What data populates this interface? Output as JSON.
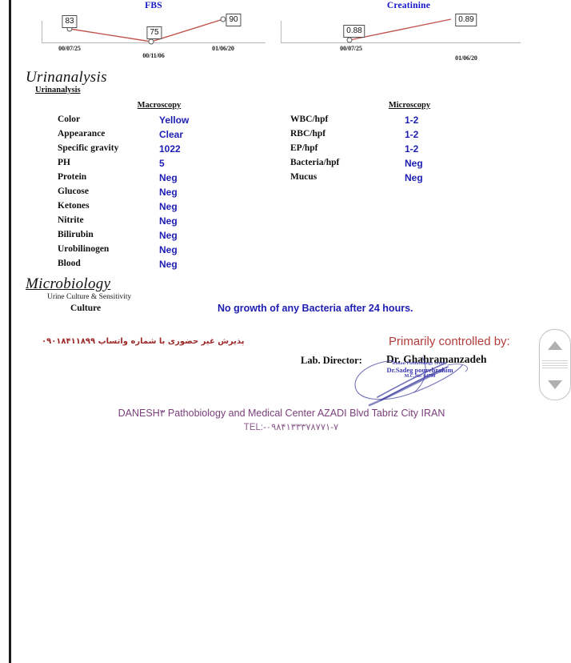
{
  "charts": {
    "fbs": {
      "title": "FBS",
      "points": [
        {
          "value": "83",
          "date": "00/07/25"
        },
        {
          "value": "75",
          "date": "00/11/06"
        },
        {
          "value": "90",
          "date": "01/06/20"
        }
      ]
    },
    "creatinine": {
      "title": "Creatinine",
      "points": [
        {
          "value": "0.88",
          "date": "00/07/25"
        },
        {
          "value": "0.89",
          "date": "01/06/20"
        }
      ]
    }
  },
  "urinalysis": {
    "section_title": "Urinanalysis",
    "sub_title": "Urinanalysis",
    "macroscopy_header": "Macroscopy",
    "microscopy_header": "Microscopy",
    "macroscopy": [
      {
        "label": "Color",
        "value": "Yellow"
      },
      {
        "label": "Appearance",
        "value": "Clear"
      },
      {
        "label": "Specific gravity",
        "value": "1022"
      },
      {
        "label": "PH",
        "value": "5"
      },
      {
        "label": "Protein",
        "value": "Neg"
      },
      {
        "label": "Glucose",
        "value": "Neg"
      },
      {
        "label": "Ketones",
        "value": "Neg"
      },
      {
        "label": "Nitrite",
        "value": "Neg"
      },
      {
        "label": "Bilirubin",
        "value": "Neg"
      },
      {
        "label": "Urobilinogen",
        "value": "Neg"
      },
      {
        "label": "Blood",
        "value": "Neg"
      }
    ],
    "microscopy": [
      {
        "label": "WBC/hpf",
        "value": "1-2"
      },
      {
        "label": "RBC/hpf",
        "value": "1-2"
      },
      {
        "label": "EP/hpf",
        "value": "1-2"
      },
      {
        "label": "Bacteria/hpf",
        "value": "Neg"
      },
      {
        "label": "Mucus",
        "value": "Neg"
      }
    ]
  },
  "microbiology": {
    "section_title": "Microbiology",
    "sub_title": "Urine Culture & Sensitivity",
    "culture_label": "Culture",
    "culture_result": "No growth of any Bacteria after 24 hours."
  },
  "footer": {
    "farsi_note": "پذیرش غیر حضوری با شماره واتساپ ۰۹۰۱۸۴۱۱۸۹۹",
    "controlled_by": "Primarily controlled by:",
    "lab_director_label": "Lab. Director:",
    "director_name": "Dr. Ghahramanzadeh",
    "stamp_line1": "Bahan Pathobiology center",
    "stamp_line2": "Dr.Sadeg pourebrahim",
    "stamp_line3": "M.C.No: 64798",
    "address": "DANESH۳ Pathobiology and Medical Center AZADI Blvd Tabriz City IRAN",
    "tel": "TEL:-۰۹۸۴۱۳۳۳۷۸۷۷۱-۷"
  },
  "scroll": {
    "up_icon": "triangle-up-icon",
    "down_icon": "triangle-down-icon"
  },
  "colors": {
    "value_blue": "#1d1db4",
    "chart_title_blue": "#1414c8",
    "chart_line_red": "#c0554f",
    "farsi_red": "#9e2a2a",
    "controlled_red": "#b43c3c",
    "address_purple": "#7a3e7a",
    "stamp_blue": "#2b2bb0"
  },
  "chart_data": [
    {
      "type": "line",
      "title": "FBS",
      "x": [
        "00/07/25",
        "00/11/06",
        "01/06/20"
      ],
      "values": [
        83,
        75,
        90
      ],
      "xlabel": "",
      "ylabel": "",
      "grid": false,
      "legend": "none",
      "data_labels": [
        "83",
        "75",
        "90"
      ],
      "line_color": "#c0554f"
    },
    {
      "type": "line",
      "title": "Creatinine",
      "x": [
        "00/07/25",
        "01/06/20"
      ],
      "values": [
        0.88,
        0.89
      ],
      "xlabel": "",
      "ylabel": "",
      "grid": false,
      "legend": "none",
      "data_labels": [
        "0.88",
        "0.89"
      ],
      "line_color": "#c0554f"
    }
  ]
}
